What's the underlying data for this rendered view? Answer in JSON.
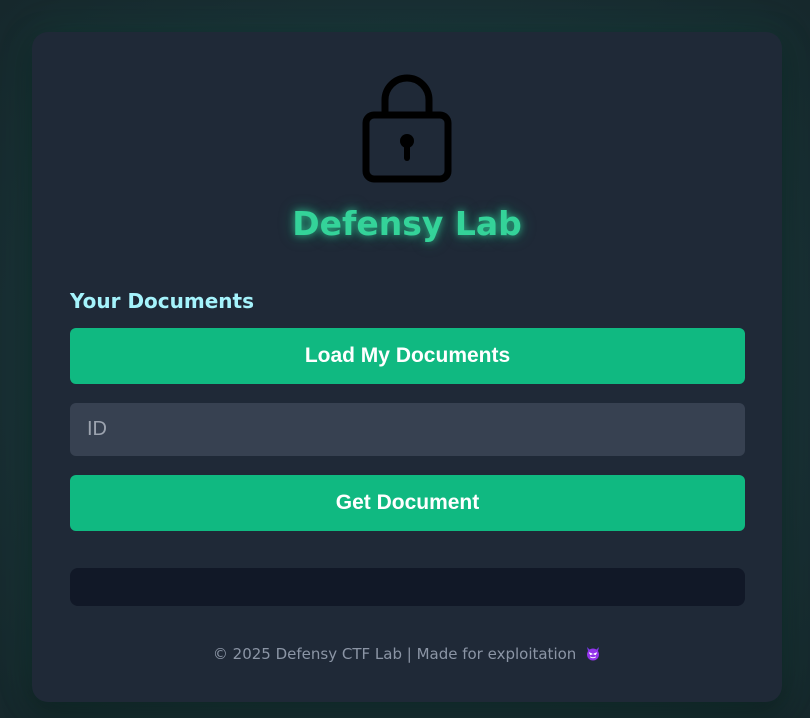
{
  "app": {
    "title": "Defensy Lab"
  },
  "documents": {
    "section_title": "Your Documents",
    "load_button_label": "Load My Documents",
    "id_input": {
      "value": "",
      "placeholder": "ID"
    },
    "get_button_label": "Get Document",
    "output": ""
  },
  "footer": {
    "text": "© 2025 Defensy CTF Lab | Made for exploitation",
    "icon": "devil-emoji-icon"
  },
  "icons": {
    "logo": "padlock-icon"
  },
  "colors": {
    "accent": "#10b981",
    "title_glow": "#34d399",
    "section_title": "#a5f3fc",
    "card_bg": "#1f2937",
    "input_bg": "#374151",
    "output_bg": "#111827"
  }
}
